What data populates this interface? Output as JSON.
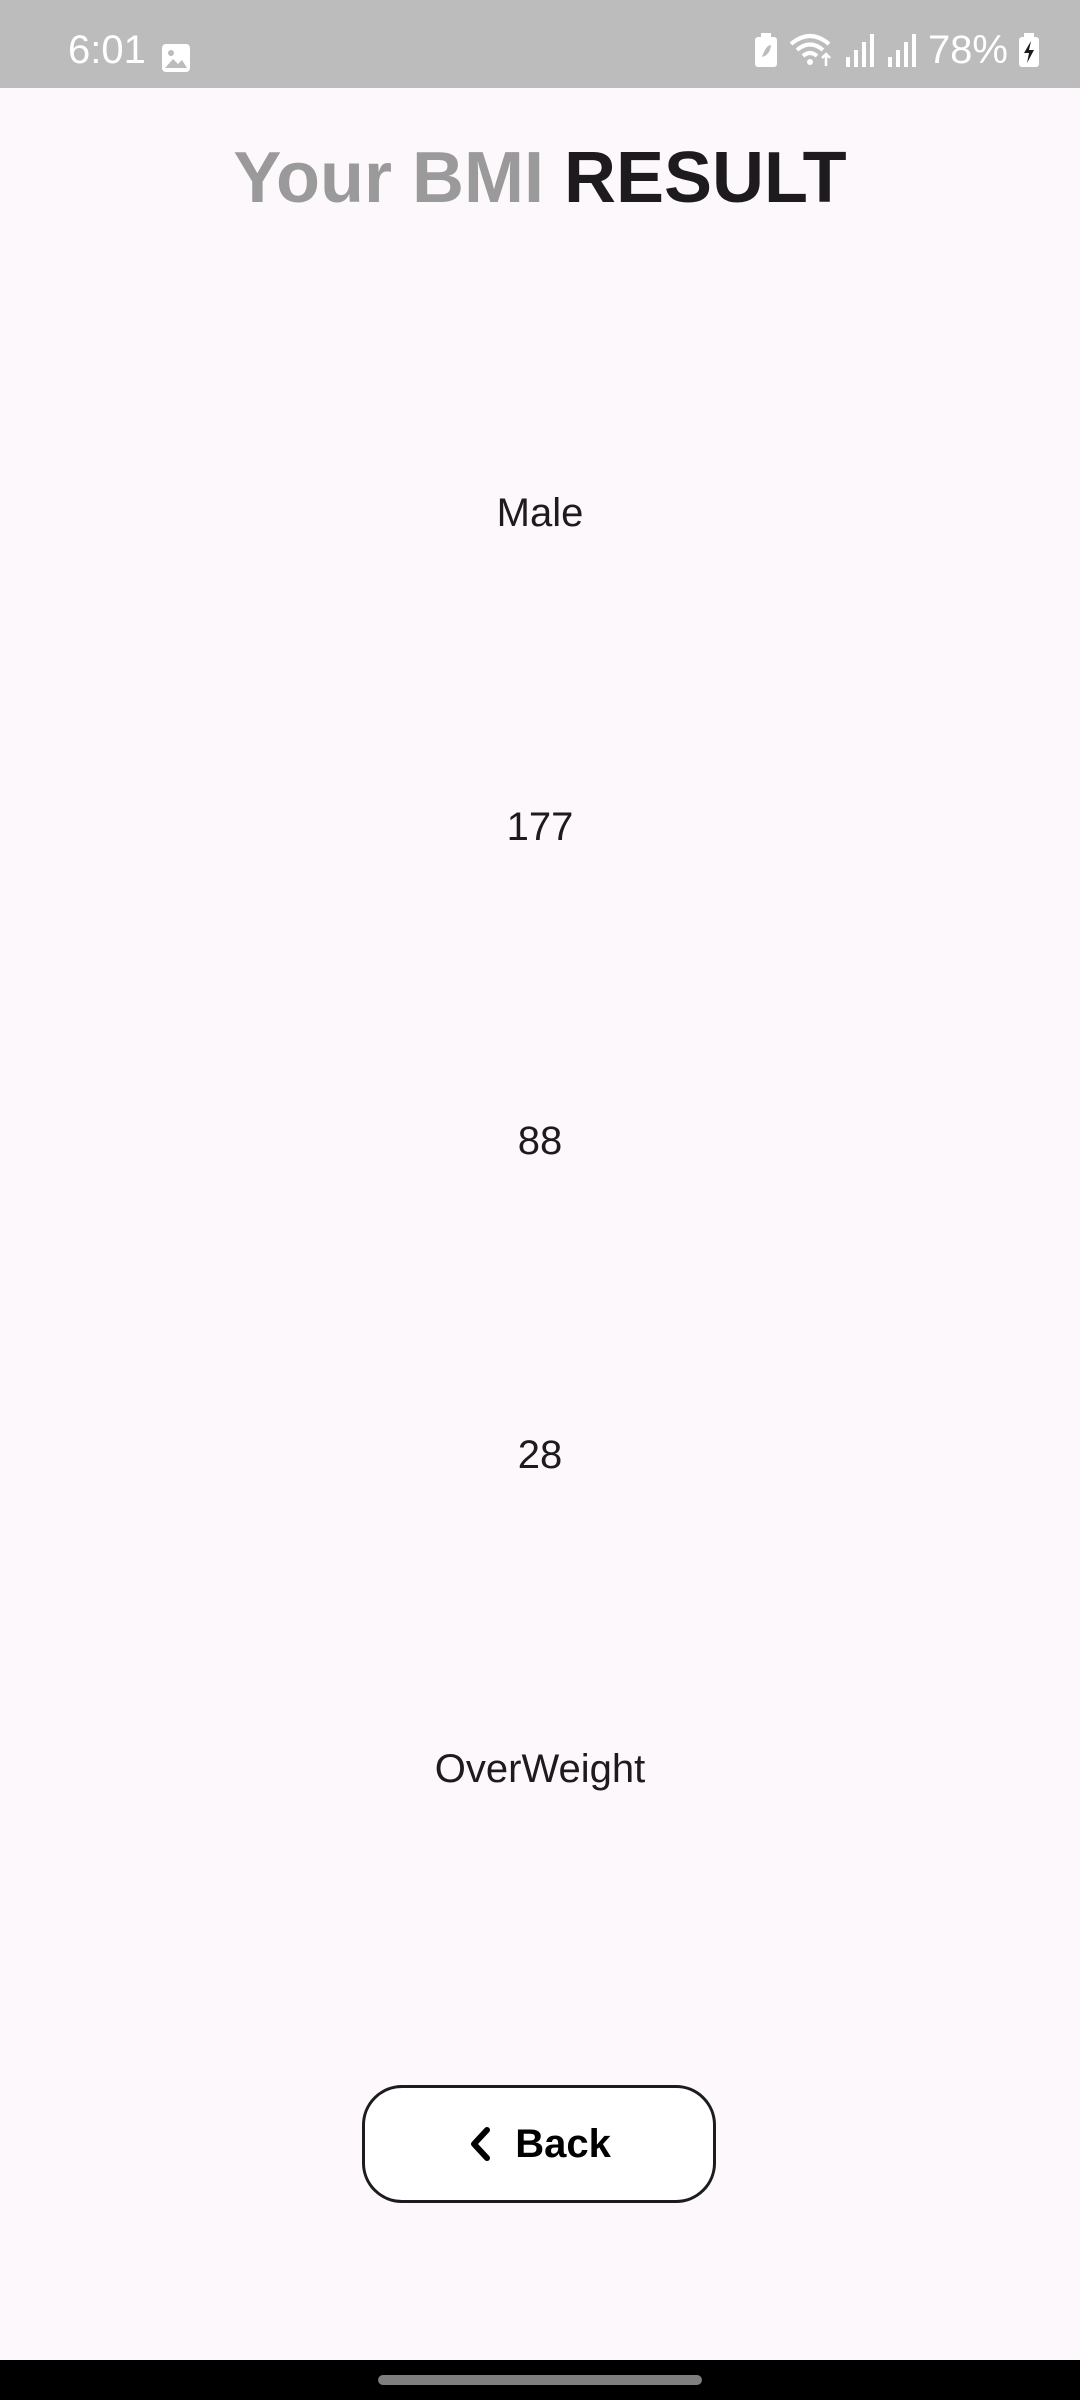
{
  "status_bar": {
    "time": "6:01",
    "battery_percent": "78%",
    "icons": [
      "gallery-icon",
      "battery-saver-icon",
      "wifi-icon",
      "signal-icon",
      "signal-icon",
      "battery-charging-icon"
    ]
  },
  "header": {
    "title_part1": "Your BMI",
    "title_part2": "RESULT"
  },
  "results": {
    "gender": "Male",
    "height": "177",
    "weight": "88",
    "bmi": "28",
    "category": "OverWeight"
  },
  "back_button": {
    "icon": "chevron-left-icon",
    "label": "Back"
  },
  "colors": {
    "background": "#fdf8fb",
    "status_bar": "#bdbcbd",
    "title_muted": "#9a9a9a",
    "title_dark": "#1d1b1e"
  }
}
